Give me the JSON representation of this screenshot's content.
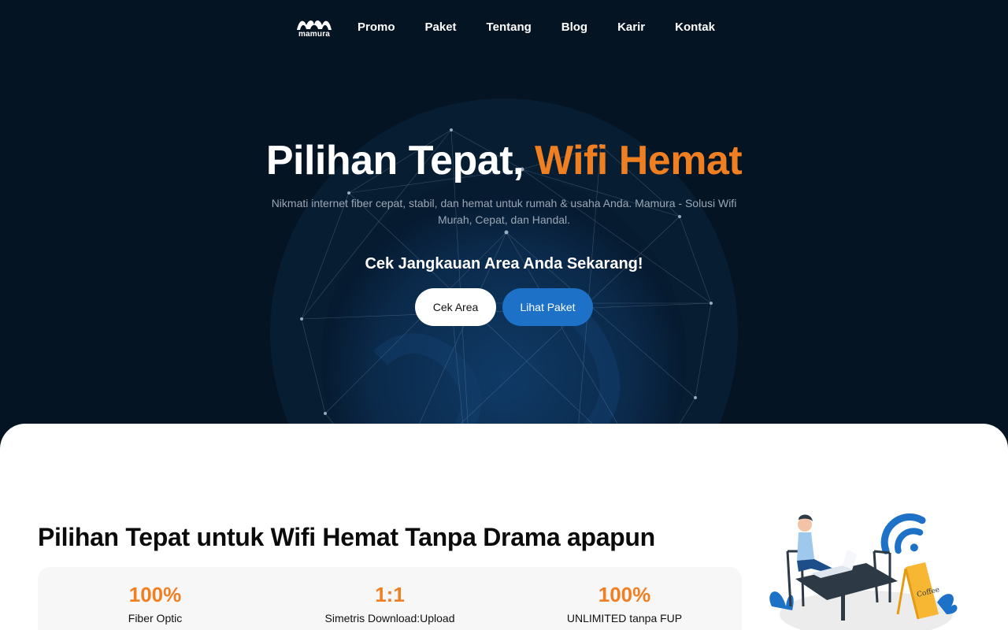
{
  "nav": {
    "logo_text": "mamura",
    "links": [
      "Promo",
      "Paket",
      "Tentang",
      "Blog",
      "Karir",
      "Kontak"
    ]
  },
  "hero": {
    "title_main": "Pilihan Tepat, ",
    "title_accent": "Wifi Hemat",
    "subtitle": "Nikmati internet fiber cepat, stabil, dan hemat untuk rumah & usaha Anda. Mamura - Solusi Wifi Murah, Cepat, dan Handal.",
    "cta_title": "Cek Jangkauan Area Anda Sekarang!",
    "btn_check": "Cek Area",
    "btn_packages": "Lihat Paket"
  },
  "section": {
    "title": "Pilihan Tepat untuk Wifi Hemat Tanpa Drama apapun",
    "stats": [
      {
        "value": "100%",
        "label": "Fiber Optic"
      },
      {
        "value": "1:1",
        "label": "Simetris Download:Upload"
      },
      {
        "value": "100%",
        "label": "UNLIMITED tanpa FUP"
      }
    ],
    "illustration_sign": "Coffee"
  },
  "colors": {
    "background": "#051423",
    "accent": "#f07f22",
    "primary_button": "#1d72c8"
  }
}
